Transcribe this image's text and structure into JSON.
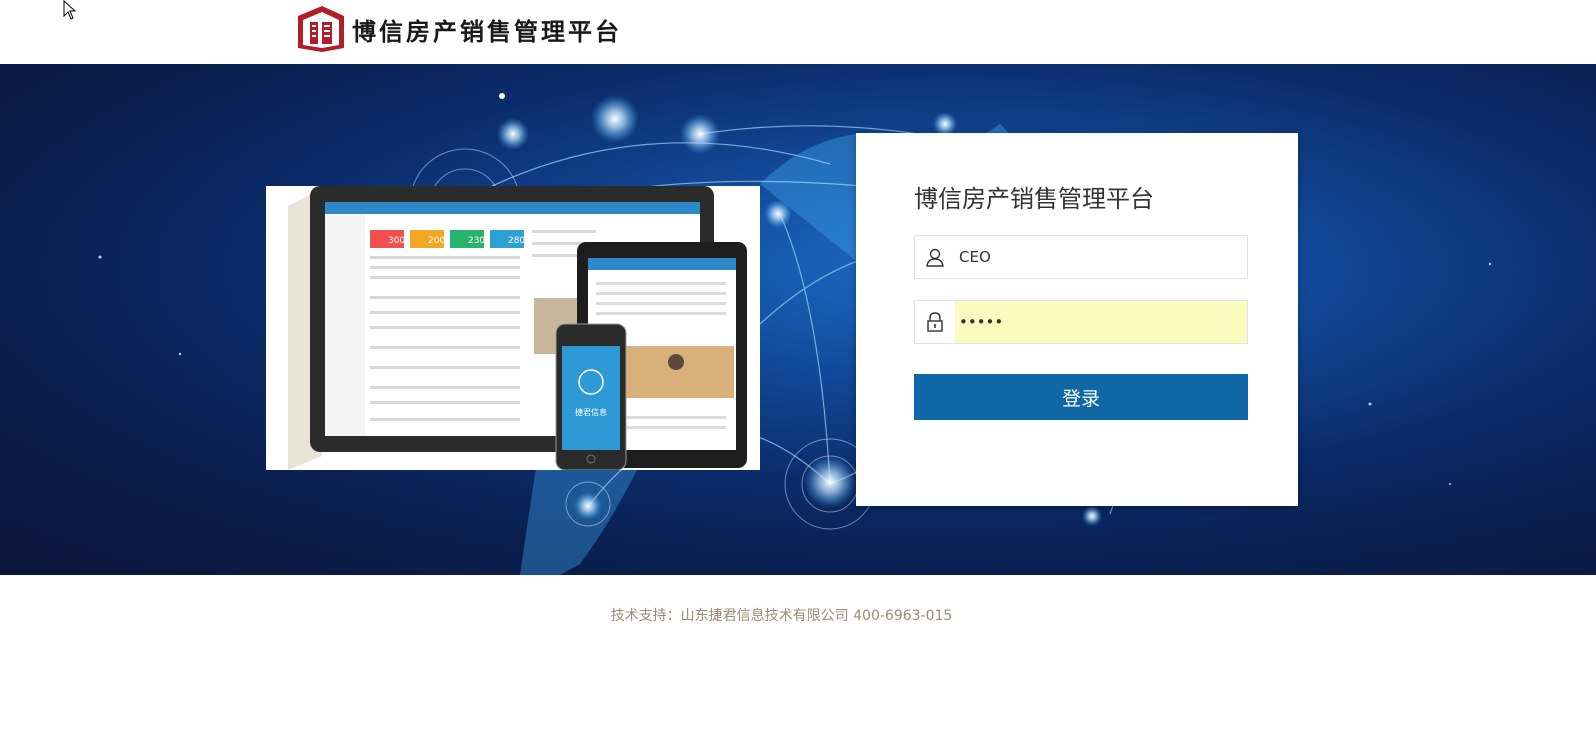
{
  "header": {
    "app_title": "博信房产销售管理平台",
    "logo_icon": "building-logo-icon"
  },
  "banner": {
    "illustration": "multi-device-preview-image",
    "phone_app_name": "捷君信息",
    "stat_values": [
      "300",
      "200",
      "230",
      "280"
    ]
  },
  "login": {
    "title": "博信房产销售管理平台",
    "username_value": "CEO",
    "password_value": "•••••",
    "submit_label": "登录",
    "user_icon": "user-icon",
    "lock_icon": "lock-icon"
  },
  "footer": {
    "support_text": "技术支持：山东捷君信息技术有限公司 400-6963-015"
  },
  "colors": {
    "accent": "#0f67a6",
    "logo_red": "#b01e2a",
    "footer_text": "#9b8b74",
    "password_fill": "#fafcbd"
  }
}
